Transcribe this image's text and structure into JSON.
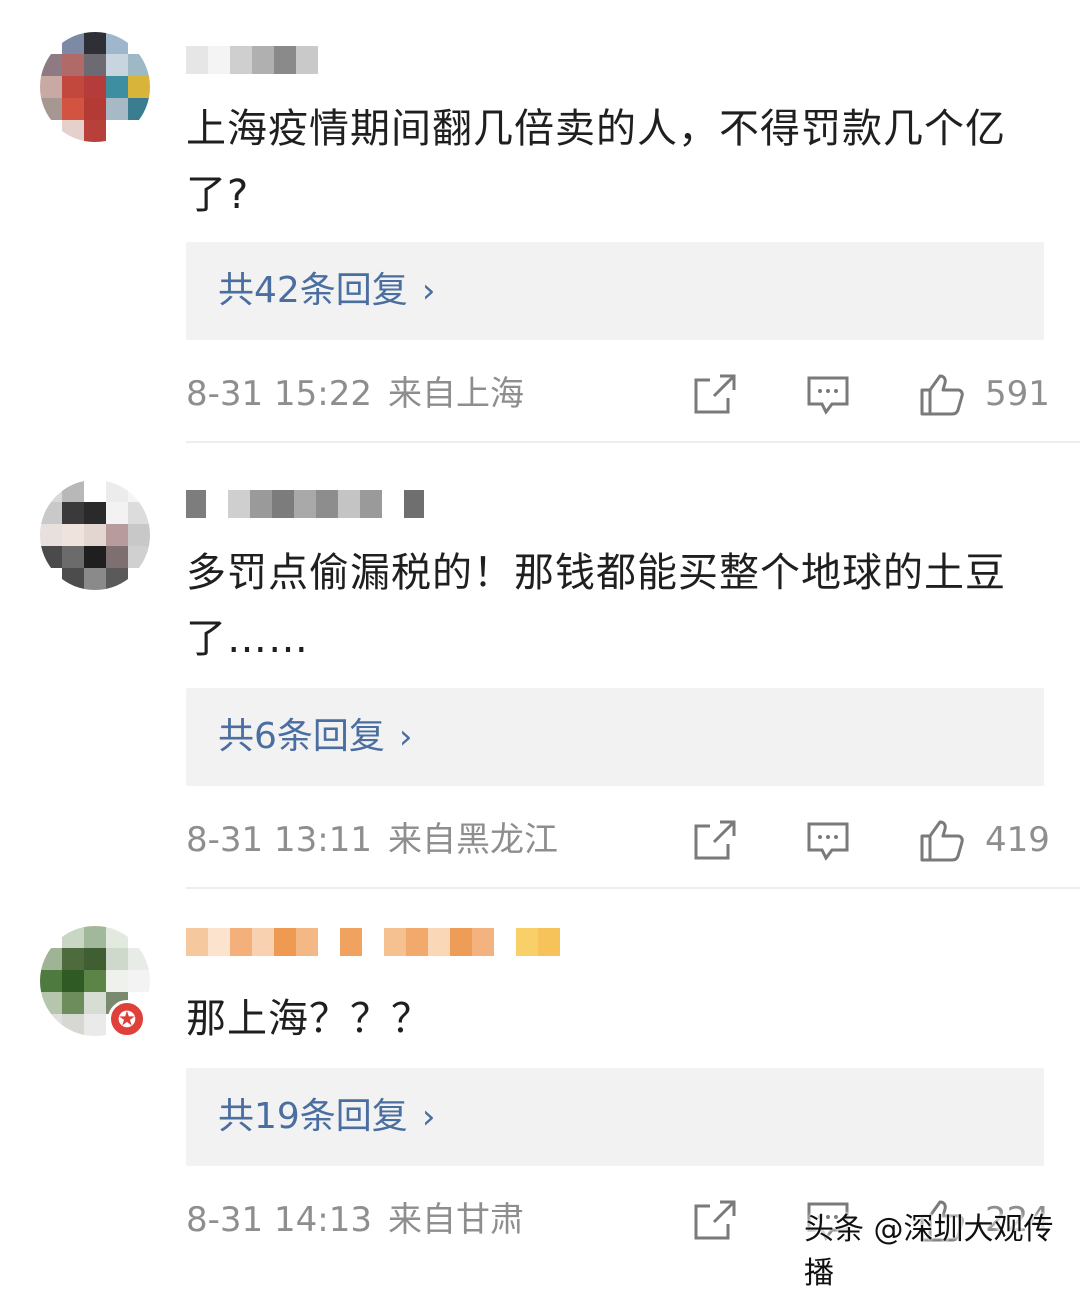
{
  "comments": [
    {
      "text": "上海疫情期间翻几倍卖的人，不得罚款几个亿了?",
      "replies_label": "共42条回复",
      "time": "8-31 15:22",
      "location": "来自上海",
      "likes": "591"
    },
    {
      "text": "多罚点偷漏税的！那钱都能买整个地球的土豆了……",
      "replies_label": "共6条回复",
      "time": "8-31 13:11",
      "location": "来自黑龙江",
      "likes": "419"
    },
    {
      "text": "那上海？？？",
      "replies_label": "共19条回复",
      "time": "8-31 14:13",
      "location": "来自甘肃",
      "likes": "224"
    }
  ],
  "icons": {
    "forward": "share-icon",
    "comment": "comment-icon",
    "like": "thumbs-up-icon",
    "chevron": "chevron-right-icon",
    "verified": "verified-badge-icon"
  },
  "colors": {
    "reply_link": "#4a6ea0",
    "meta_text": "#8e8e8e",
    "reply_box": "#f2f2f2"
  },
  "chevron_glyph": "›",
  "watermark": "头条 @深圳大观传播"
}
